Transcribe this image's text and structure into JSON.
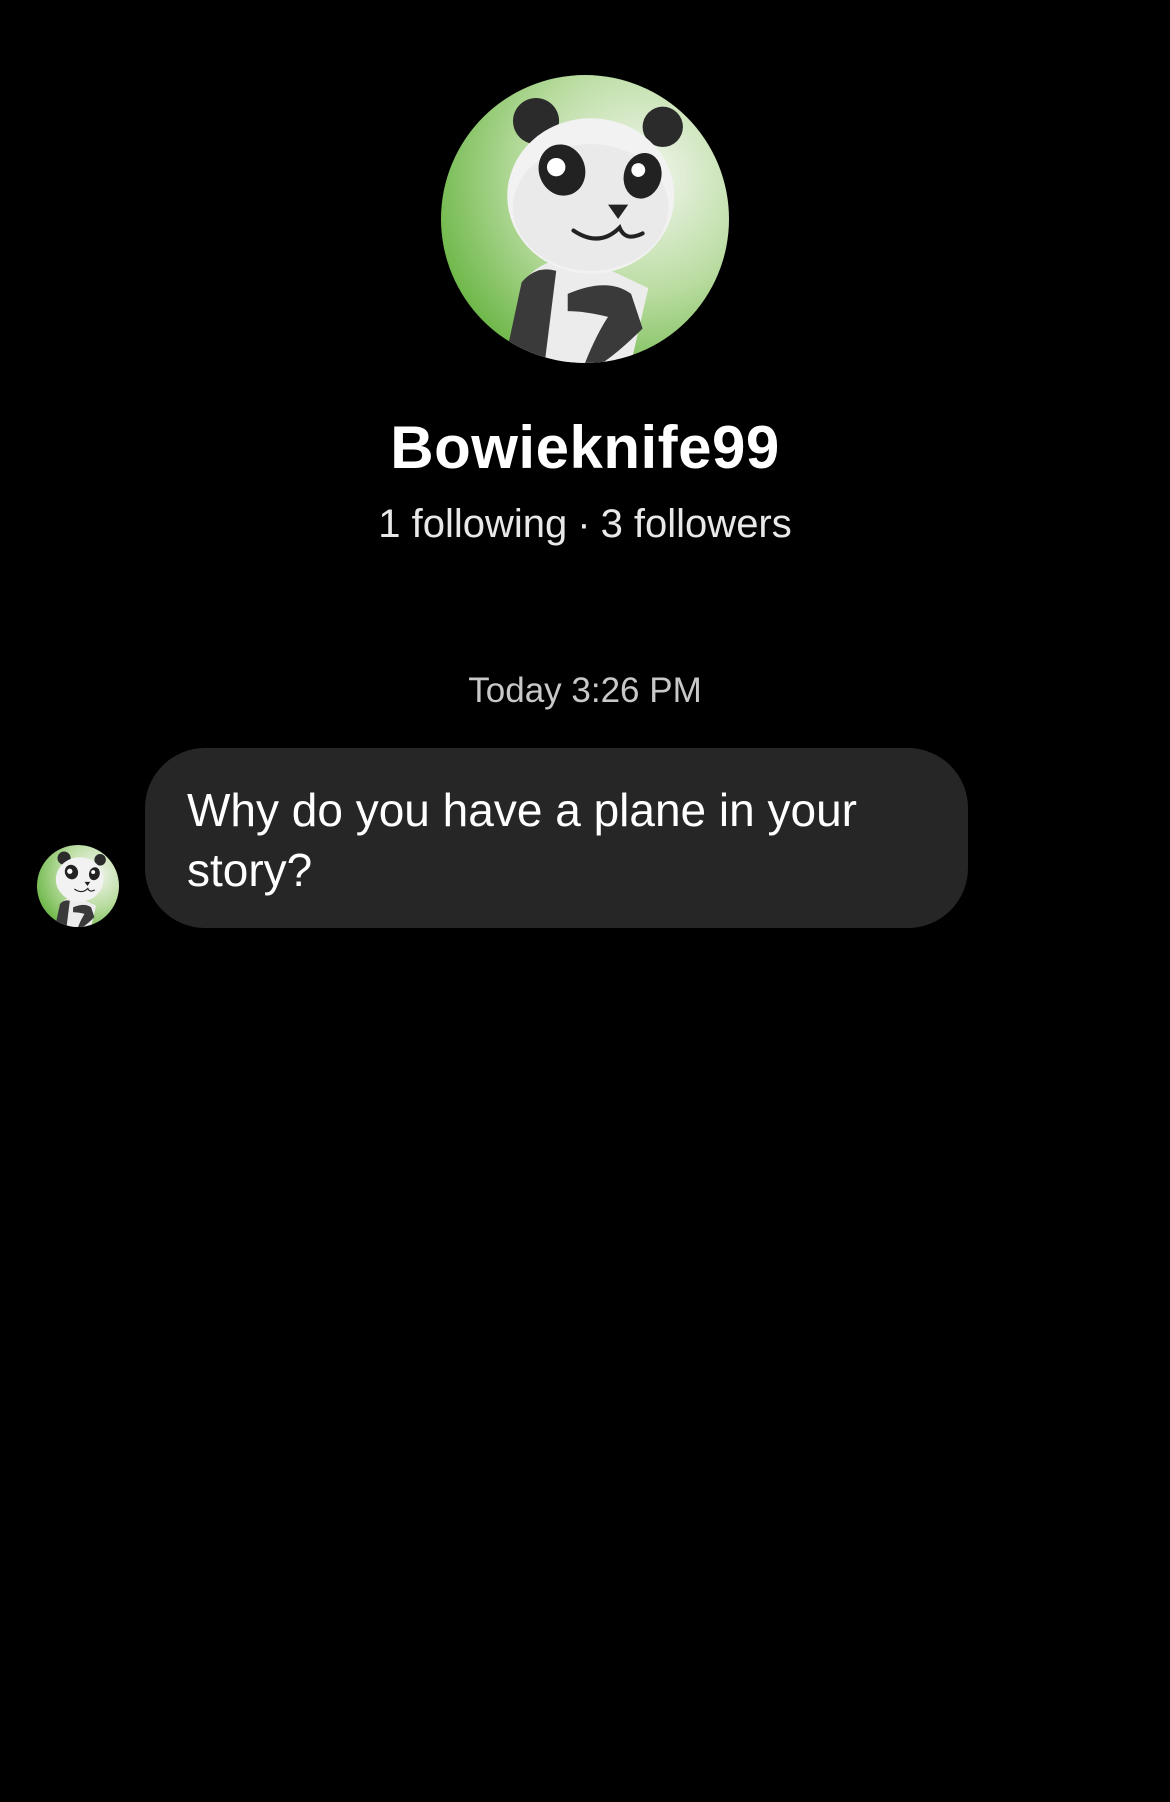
{
  "profile": {
    "avatar_icon": "panda-avatar-icon",
    "username": "Bowieknife99",
    "following": "1 following",
    "separator": "·",
    "followers": "3 followers"
  },
  "conversation": {
    "timestamp": "Today 3:26 PM",
    "messages": [
      {
        "sender": "Bowieknife99",
        "avatar_icon": "panda-avatar-icon",
        "text": "Why do you have a plane in your story?"
      }
    ]
  },
  "colors": {
    "background": "#000000",
    "bubble": "#262626",
    "text": "#ffffff",
    "muted_text": "#c8c8c8",
    "avatar_bg": "#7fc45a"
  }
}
